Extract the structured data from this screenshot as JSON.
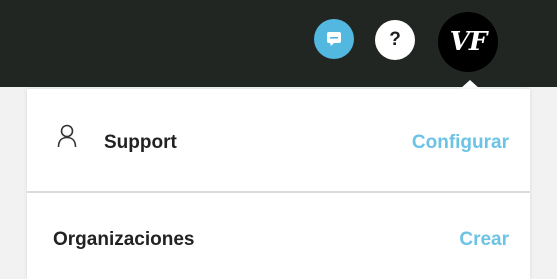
{
  "header": {
    "chat_icon": "chat-icon",
    "help_label": "?",
    "avatar_initials": "VF"
  },
  "menu": {
    "support": {
      "icon": "user-icon",
      "label": "Support",
      "action_label": "Configurar"
    },
    "organizations": {
      "label": "Organizaciones",
      "action_label": "Crear"
    }
  },
  "colors": {
    "topbar": "#222623",
    "accent": "#6cc3e3",
    "chat_button": "#52b8e0"
  }
}
